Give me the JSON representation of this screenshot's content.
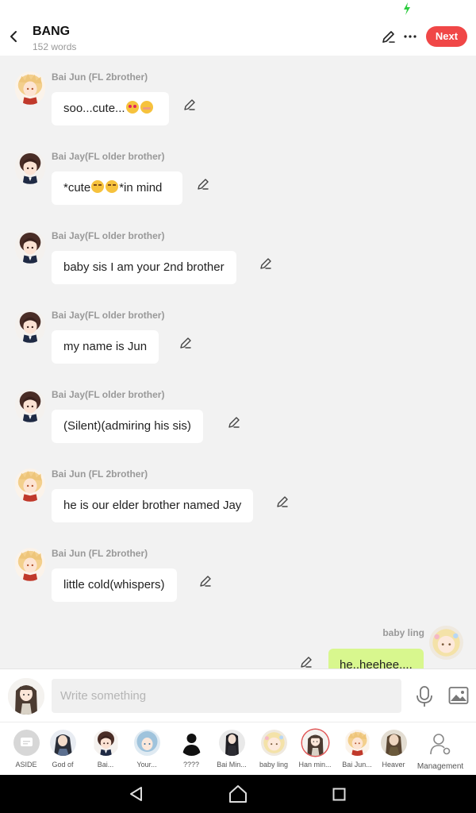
{
  "header": {
    "title": "BANG",
    "word_count": "152 words",
    "next_label": "Next"
  },
  "messages": [
    {
      "sender": "Bai Jun (FL 2brother)",
      "text_parts": [
        "soo...cute...",
        "",
        ""
      ],
      "emojis": [
        "love",
        "shy"
      ],
      "avatar": "blond-boy"
    },
    {
      "sender": "Bai Jay(FL older brother)",
      "text_parts": [
        "*cute",
        "",
        "*in mind"
      ],
      "emojis": [
        "mad",
        "mad"
      ],
      "avatar": "dark-boy"
    },
    {
      "sender": "Bai Jay(FL older brother)",
      "text": "baby sis I am your 2nd brother",
      "avatar": "dark-boy"
    },
    {
      "sender": "Bai Jay(FL older brother)",
      "text": "my name is Jun",
      "avatar": "dark-boy"
    },
    {
      "sender": "Bai Jay(FL older brother)",
      "text": "(Silent)(admiring his sis)",
      "avatar": "dark-boy"
    },
    {
      "sender": "Bai Jun (FL 2brother)",
      "text": "he is our elder brother named Jay",
      "avatar": "blond-boy"
    },
    {
      "sender": "Bai Jun (FL 2brother)",
      "text": "little cold(whispers)",
      "avatar": "blond-boy"
    }
  ],
  "own_message": {
    "sender": "baby ling",
    "text": "he..heehee...."
  },
  "composer": {
    "placeholder": "Write something"
  },
  "characters": [
    {
      "label": "ASIDE",
      "kind": "aside"
    },
    {
      "label": "God of",
      "kind": "dark-man"
    },
    {
      "label": "Bai...",
      "kind": "dark-boy"
    },
    {
      "label": "Your...",
      "kind": "blue-girl"
    },
    {
      "label": "????",
      "kind": "silhouette"
    },
    {
      "label": "Bai Min...",
      "kind": "dark-suit"
    },
    {
      "label": "baby ling",
      "kind": "blond-girl"
    },
    {
      "label": "Han min...",
      "kind": "brown-girl",
      "selected": true
    },
    {
      "label": "Bai Jun...",
      "kind": "blond-boy"
    },
    {
      "label": "Heaver",
      "kind": "brown-man"
    }
  ],
  "management_label": "Management",
  "icons": [
    "charge-icon",
    "back-arrow-icon",
    "pencil-icon",
    "more-icon",
    "mic-icon",
    "image-icon",
    "management-icon",
    "nav-back-icon",
    "nav-home-icon",
    "nav-recents-icon"
  ],
  "colors": {
    "accent": "#f04747",
    "own_bubble": "#d8f78e",
    "background": "#f2f2f2"
  }
}
